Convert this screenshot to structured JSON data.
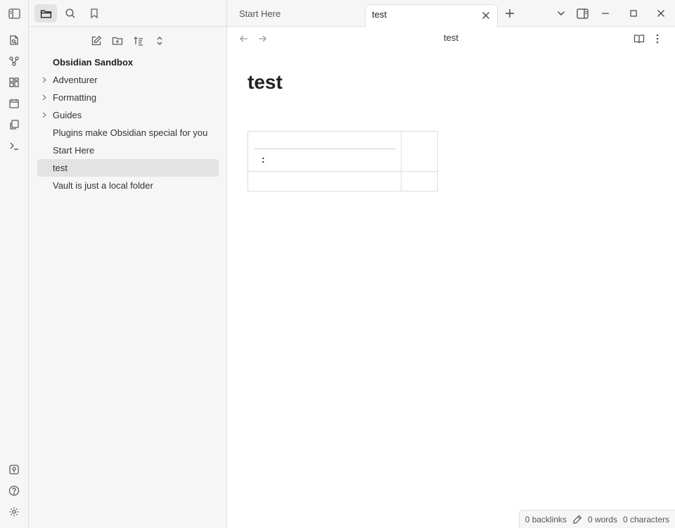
{
  "ribbon": {
    "items": [
      {
        "icon": "open-quick-switcher-icon"
      },
      {
        "icon": "graph-view-icon"
      },
      {
        "icon": "canvas-icon"
      },
      {
        "icon": "daily-note-icon"
      },
      {
        "icon": "templates-icon"
      },
      {
        "icon": "command-palette-icon"
      }
    ],
    "bottom": [
      {
        "icon": "vault-switcher-icon"
      },
      {
        "icon": "help-icon"
      },
      {
        "icon": "settings-icon"
      }
    ]
  },
  "sidebar": {
    "tabs": [
      {
        "icon": "sidebar-toggle-icon",
        "active": false
      },
      {
        "icon": "folder-icon",
        "active": true
      },
      {
        "icon": "search-icon",
        "active": false
      },
      {
        "icon": "bookmark-icon",
        "active": false
      }
    ],
    "actions": [
      {
        "icon": "new-note-icon"
      },
      {
        "icon": "new-folder-icon"
      },
      {
        "icon": "sort-icon"
      },
      {
        "icon": "collapse-all-icon"
      }
    ],
    "vault_name": "Obsidian Sandbox",
    "tree": [
      {
        "label": "Adventurer",
        "folder": true
      },
      {
        "label": "Formatting",
        "folder": true
      },
      {
        "label": "Guides",
        "folder": true
      },
      {
        "label": "Plugins make Obsidian special for you",
        "folder": false
      },
      {
        "label": "Start Here",
        "folder": false
      },
      {
        "label": "test",
        "folder": false,
        "selected": true
      },
      {
        "label": "Vault is just a local folder",
        "folder": false
      }
    ]
  },
  "tabs": [
    {
      "label": "Start Here",
      "active": false
    },
    {
      "label": "test",
      "active": true
    }
  ],
  "view": {
    "title": "test",
    "doc_title": "test",
    "table_cell_text": ":"
  },
  "status": {
    "backlinks": "0 backlinks",
    "words": "0 words",
    "characters": "0 characters"
  }
}
